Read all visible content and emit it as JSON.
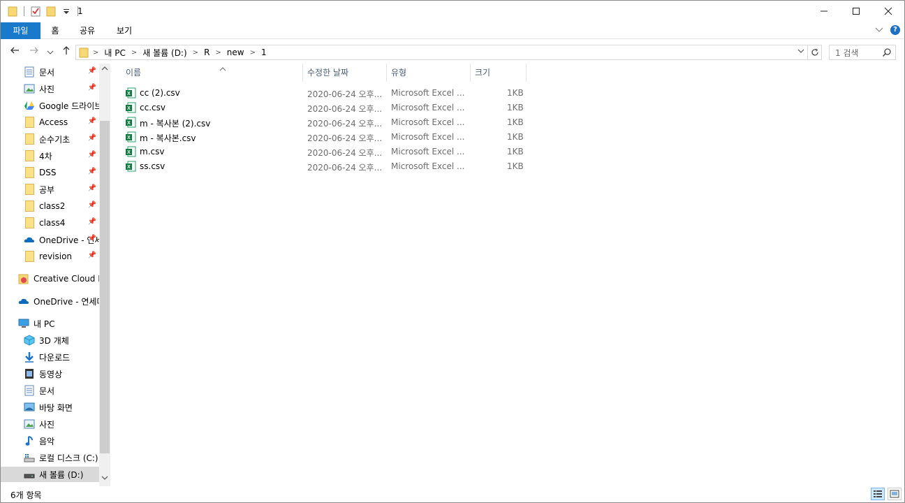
{
  "window": {
    "title": "1"
  },
  "ribbon": {
    "tabs": [
      "파일",
      "홈",
      "공유",
      "보기"
    ]
  },
  "navigation": {
    "breadcrumb": [
      "내 PC",
      "새 볼륨 (D:)",
      "R",
      "new",
      "1"
    ]
  },
  "search": {
    "placeholder": "1 검색"
  },
  "sidebar": {
    "items": [
      {
        "label": "문서",
        "icon": "documents-icon",
        "pinned": true
      },
      {
        "label": "사진",
        "icon": "pictures-icon",
        "pinned": true
      },
      {
        "label": "Google 드라이브",
        "icon": "google-drive-icon",
        "pinned": true
      },
      {
        "label": "Access",
        "icon": "folder-icon",
        "pinned": true
      },
      {
        "label": "순수기초",
        "icon": "folder-icon",
        "pinned": true
      },
      {
        "label": "4차",
        "icon": "folder-icon",
        "pinned": true
      },
      {
        "label": "DSS",
        "icon": "folder-icon",
        "pinned": true
      },
      {
        "label": "공부",
        "icon": "folder-icon",
        "pinned": true
      },
      {
        "label": "class2",
        "icon": "folder-icon",
        "pinned": true
      },
      {
        "label": "class4",
        "icon": "folder-icon",
        "pinned": true
      },
      {
        "label": "OneDrive - 연세대학교",
        "icon": "onedrive-icon",
        "pinned": true
      },
      {
        "label": "revision",
        "icon": "folder-icon",
        "pinned": true
      }
    ],
    "creative_cloud": "Creative Cloud Files",
    "onedrive": "OneDrive - 연세대학교",
    "this_pc": "내 PC",
    "pc_items": [
      {
        "label": "3D 개체",
        "icon": "3d-objects-icon"
      },
      {
        "label": "다운로드",
        "icon": "downloads-icon"
      },
      {
        "label": "동영상",
        "icon": "videos-icon"
      },
      {
        "label": "문서",
        "icon": "documents-icon"
      },
      {
        "label": "바탕 화면",
        "icon": "desktop-icon"
      },
      {
        "label": "사진",
        "icon": "pictures-icon"
      },
      {
        "label": "음악",
        "icon": "music-icon"
      },
      {
        "label": "로컬 디스크 (C:)",
        "icon": "local-disk-icon"
      },
      {
        "label": "새 볼륨 (D:)",
        "icon": "drive-icon"
      }
    ]
  },
  "columns": {
    "name": "이름",
    "date": "수정한 날짜",
    "type": "유형",
    "size": "크기"
  },
  "files": [
    {
      "name": "cc (2).csv",
      "date": "2020-06-24 오후...",
      "type": "Microsoft Excel ...",
      "size": "1KB"
    },
    {
      "name": "cc.csv",
      "date": "2020-06-24 오후...",
      "type": "Microsoft Excel ...",
      "size": "1KB"
    },
    {
      "name": "m - 복사본 (2).csv",
      "date": "2020-06-24 오후...",
      "type": "Microsoft Excel ...",
      "size": "1KB"
    },
    {
      "name": "m - 복사본.csv",
      "date": "2020-06-24 오후...",
      "type": "Microsoft Excel ...",
      "size": "1KB"
    },
    {
      "name": "m.csv",
      "date": "2020-06-24 오후...",
      "type": "Microsoft Excel ...",
      "size": "1KB"
    },
    {
      "name": "ss.csv",
      "date": "2020-06-24 오후...",
      "type": "Microsoft Excel ...",
      "size": "1KB"
    }
  ],
  "status": {
    "item_count": "6개 항목"
  }
}
